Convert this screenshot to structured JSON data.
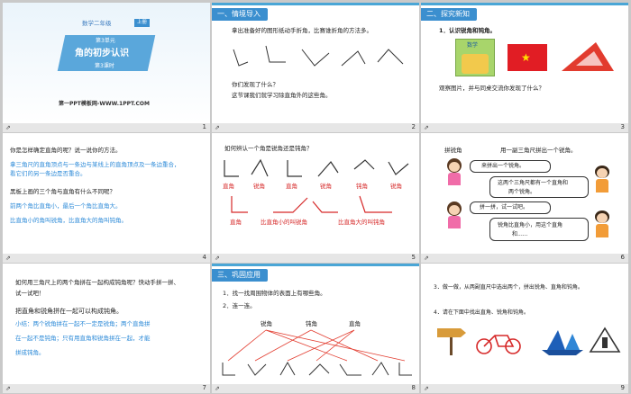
{
  "slide1": {
    "subject": "数学二年级",
    "badge": "上册",
    "unit": "第3单元",
    "title": "角的初步认识",
    "lesson": "第3课时",
    "site": "第一PPT模板网-WWW.1PPT.COM",
    "page": "1"
  },
  "slide2": {
    "section": "一、情境导入",
    "line1": "拿出准备好的图形纸动手折角，比赛谁折角的方法多。",
    "line2": "你们发现了什么？",
    "line3": "这节课我们就学习除直角外的这些角。",
    "page": "2"
  },
  "slide3": {
    "section": "二、探究新知",
    "item1": "1．认识锐角和钝角。",
    "book_label": "数学",
    "line": "观察图片，并与同桌交流你发现了什么？",
    "page": "3"
  },
  "slide4": {
    "q1": "你是怎样确定直角的呢？说一说你的方法。",
    "a1a": "拿三角尺的直角顶点与一条边与某线上的直角顶点及一条边重合，",
    "a1b": "看它们的另一条边是否重合。",
    "q2": "黑板上画的三个角与直角有什么不同呢？",
    "a2a": "前两个角比直角小，最后一个角比直角大。",
    "a2b": "比直角小的角叫锐角，比直角大的角叫钝角。",
    "page": "4"
  },
  "slide5": {
    "q": "如何辨认一个角是锐角还是钝角？",
    "labels_row1": [
      "直角",
      "锐角",
      "直角",
      "锐角",
      "钝角",
      "锐角"
    ],
    "labels_row2": [
      "直角",
      "比直角小的叫锐角",
      "比直角大的叫钝角"
    ],
    "page": "5"
  },
  "slide6": {
    "title": "拼锐角",
    "hint": "用一副三角尺拼出一个锐角。",
    "b1": "来拼出一个锐角。",
    "b2a": "这两个三角尺都有一个直角和",
    "b2b": "两个锐角。",
    "b3": "拼一拼，试一试吧。",
    "b4a": "锐角比直角小，用这个直角",
    "b4b": "和......",
    "page": "6"
  },
  "slide7": {
    "q1a": "如何用三角尺上的两个角拼在一起构成钝角呢？快动手拼一拼、",
    "q1b": "试一试吧！",
    "q2": "把直角和锐角拼在一起可以构成钝角。",
    "s1": "小结：两个锐角拼在一起不一定是锐角；两个直角拼",
    "s2": "在一起不是钝角；只有用直角和锐角拼在一起，才能",
    "s3": "拼成钝角。",
    "page": "7"
  },
  "slide8": {
    "section": "三、巩固应用",
    "item1": "1．找一找周围物体的表面上有哪些角。",
    "item2": "2．连一连。",
    "labels": [
      "锐角",
      "钝角",
      "直角"
    ],
    "page": "8"
  },
  "slide9": {
    "item3": "3．做一做，从两副直尺中选出两个，拼出锐角、直角和钝角。",
    "item4": "4．请在下面中找出直角、锐角和钝角。",
    "page": "9"
  },
  "colors": {
    "accent": "#3b8fcf",
    "answer_blue": "#2e8bd8",
    "answer_red": "#d62828",
    "background": "#c9c9c9"
  },
  "footer_icon": "share-icon"
}
